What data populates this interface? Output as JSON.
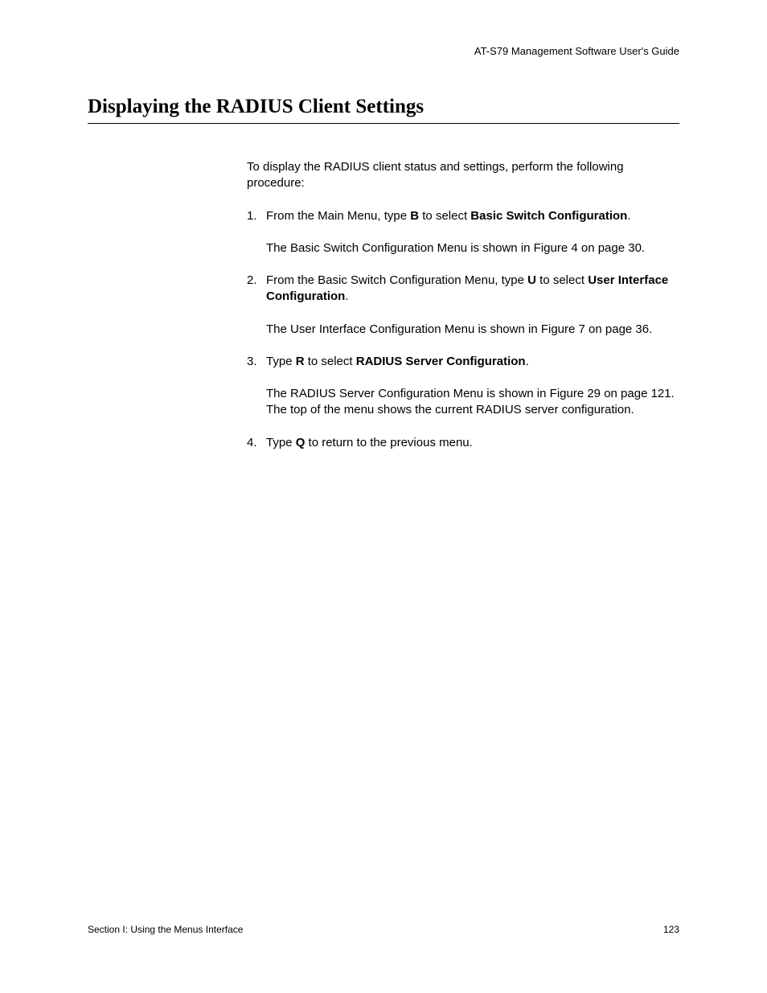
{
  "header": {
    "guide": "AT-S79 Management Software User's Guide"
  },
  "heading": "Displaying the RADIUS Client Settings",
  "intro": "To display the RADIUS client status and settings, perform the following procedure:",
  "steps": {
    "s1": {
      "num": "1.",
      "pre": "From the Main Menu, type ",
      "key": "B",
      "mid": " to select ",
      "sel": "Basic Switch Configuration",
      "post": ".",
      "sub": "The Basic Switch Configuration Menu is shown in Figure 4 on page 30."
    },
    "s2": {
      "num": "2.",
      "pre": "From the Basic Switch Configuration Menu, type ",
      "key": "U",
      "mid": " to select ",
      "sel": "User Interface Configuration",
      "post": ".",
      "sub": "The User Interface Configuration Menu is shown in Figure 7 on page 36."
    },
    "s3": {
      "num": "3.",
      "pre": "Type ",
      "key": "R",
      "mid": " to select ",
      "sel": "RADIUS Server Configuration",
      "post": ".",
      "sub": "The RADIUS Server Configuration Menu is shown in Figure 29 on page 121. The top of the menu shows the current RADIUS server configuration."
    },
    "s4": {
      "num": "4.",
      "pre": "Type ",
      "key": "Q",
      "mid": " to return to the previous menu.",
      "sel": "",
      "post": ""
    }
  },
  "footer": {
    "left": "Section I: Using the Menus Interface",
    "right": "123"
  }
}
